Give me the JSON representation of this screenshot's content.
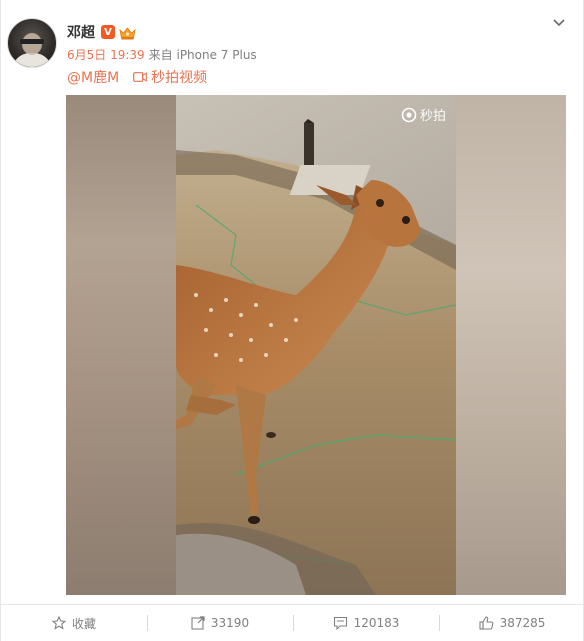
{
  "post": {
    "username": "邓超",
    "verified_mark": "V",
    "date": "6月5日 19:39",
    "source": "来自 iPhone 7 Plus",
    "mention": "@M鹿M",
    "video_link_label": "秒拍视频"
  },
  "video": {
    "watermark": "秒拍",
    "play_state": "paused"
  },
  "actions": {
    "favorite_label": "收藏",
    "share_count": "33190",
    "comment_count": "120183",
    "like_count": "387285"
  },
  "colors": {
    "accent": "#eb7350",
    "text": "#333333",
    "muted": "#808080",
    "verified": "#f15a22",
    "divider": "#e6e6e6"
  },
  "icons": {
    "options": "chevron-down-icon",
    "video_link": "video-camera-icon",
    "favorite": "star-icon",
    "share": "share-icon",
    "comment": "comment-icon",
    "like": "thumbs-up-icon"
  }
}
